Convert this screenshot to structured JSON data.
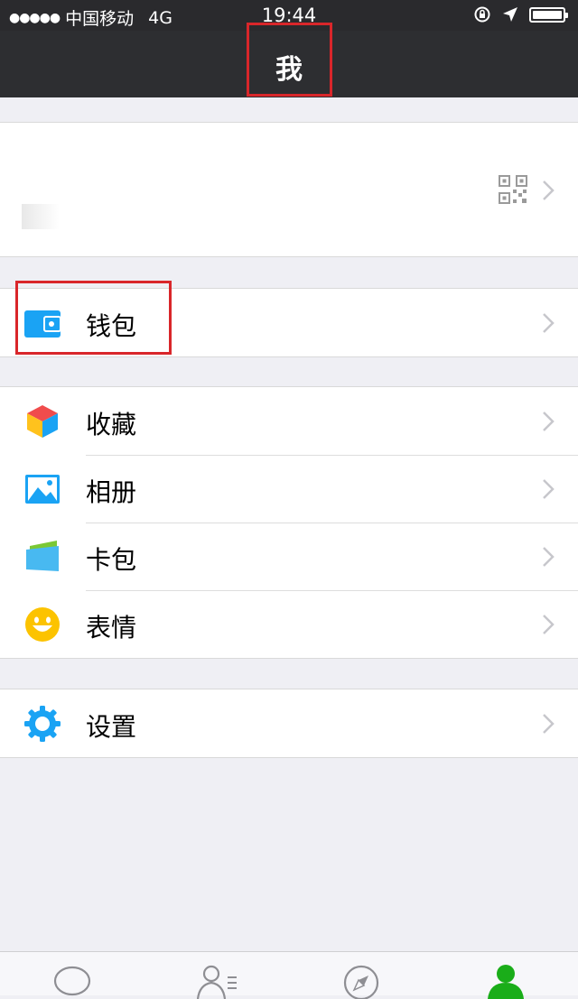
{
  "status_bar": {
    "signal": "●●●●●",
    "carrier": "中国移动",
    "network": "4G",
    "time": "19:44"
  },
  "nav": {
    "title": "我"
  },
  "colors": {
    "highlight": "#d9262a",
    "wallet_blue": "#1aa3f4",
    "header_bg": "#2d2e31",
    "background": "#efeff4",
    "tab_active": "#1aad19"
  },
  "menu": {
    "wallet": {
      "label": "钱包",
      "icon": "wallet-icon"
    },
    "favorites": {
      "label": "收藏",
      "icon": "favorites-cube-icon"
    },
    "album": {
      "label": "相册",
      "icon": "album-picture-icon"
    },
    "cards": {
      "label": "卡包",
      "icon": "card-pack-icon"
    },
    "stickers": {
      "label": "表情",
      "icon": "smiley-icon"
    },
    "settings": {
      "label": "设置",
      "icon": "gear-icon"
    }
  },
  "tabs": [
    {
      "icon": "chat-bubble-icon",
      "active": false
    },
    {
      "icon": "contacts-icon",
      "active": false
    },
    {
      "icon": "compass-icon",
      "active": false
    },
    {
      "icon": "person-icon",
      "active": true
    }
  ]
}
